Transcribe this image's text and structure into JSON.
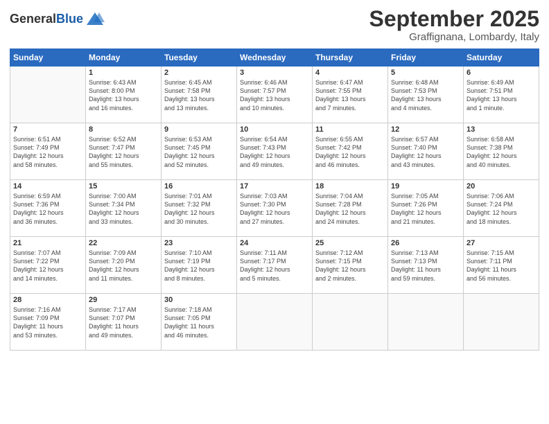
{
  "logo": {
    "general": "General",
    "blue": "Blue"
  },
  "title": "September 2025",
  "subtitle": "Graffignana, Lombardy, Italy",
  "days_of_week": [
    "Sunday",
    "Monday",
    "Tuesday",
    "Wednesday",
    "Thursday",
    "Friday",
    "Saturday"
  ],
  "weeks": [
    [
      {
        "num": "",
        "info": ""
      },
      {
        "num": "1",
        "info": "Sunrise: 6:43 AM\nSunset: 8:00 PM\nDaylight: 13 hours\nand 16 minutes."
      },
      {
        "num": "2",
        "info": "Sunrise: 6:45 AM\nSunset: 7:58 PM\nDaylight: 13 hours\nand 13 minutes."
      },
      {
        "num": "3",
        "info": "Sunrise: 6:46 AM\nSunset: 7:57 PM\nDaylight: 13 hours\nand 10 minutes."
      },
      {
        "num": "4",
        "info": "Sunrise: 6:47 AM\nSunset: 7:55 PM\nDaylight: 13 hours\nand 7 minutes."
      },
      {
        "num": "5",
        "info": "Sunrise: 6:48 AM\nSunset: 7:53 PM\nDaylight: 13 hours\nand 4 minutes."
      },
      {
        "num": "6",
        "info": "Sunrise: 6:49 AM\nSunset: 7:51 PM\nDaylight: 13 hours\nand 1 minute."
      }
    ],
    [
      {
        "num": "7",
        "info": "Sunrise: 6:51 AM\nSunset: 7:49 PM\nDaylight: 12 hours\nand 58 minutes."
      },
      {
        "num": "8",
        "info": "Sunrise: 6:52 AM\nSunset: 7:47 PM\nDaylight: 12 hours\nand 55 minutes."
      },
      {
        "num": "9",
        "info": "Sunrise: 6:53 AM\nSunset: 7:45 PM\nDaylight: 12 hours\nand 52 minutes."
      },
      {
        "num": "10",
        "info": "Sunrise: 6:54 AM\nSunset: 7:43 PM\nDaylight: 12 hours\nand 49 minutes."
      },
      {
        "num": "11",
        "info": "Sunrise: 6:55 AM\nSunset: 7:42 PM\nDaylight: 12 hours\nand 46 minutes."
      },
      {
        "num": "12",
        "info": "Sunrise: 6:57 AM\nSunset: 7:40 PM\nDaylight: 12 hours\nand 43 minutes."
      },
      {
        "num": "13",
        "info": "Sunrise: 6:58 AM\nSunset: 7:38 PM\nDaylight: 12 hours\nand 40 minutes."
      }
    ],
    [
      {
        "num": "14",
        "info": "Sunrise: 6:59 AM\nSunset: 7:36 PM\nDaylight: 12 hours\nand 36 minutes."
      },
      {
        "num": "15",
        "info": "Sunrise: 7:00 AM\nSunset: 7:34 PM\nDaylight: 12 hours\nand 33 minutes."
      },
      {
        "num": "16",
        "info": "Sunrise: 7:01 AM\nSunset: 7:32 PM\nDaylight: 12 hours\nand 30 minutes."
      },
      {
        "num": "17",
        "info": "Sunrise: 7:03 AM\nSunset: 7:30 PM\nDaylight: 12 hours\nand 27 minutes."
      },
      {
        "num": "18",
        "info": "Sunrise: 7:04 AM\nSunset: 7:28 PM\nDaylight: 12 hours\nand 24 minutes."
      },
      {
        "num": "19",
        "info": "Sunrise: 7:05 AM\nSunset: 7:26 PM\nDaylight: 12 hours\nand 21 minutes."
      },
      {
        "num": "20",
        "info": "Sunrise: 7:06 AM\nSunset: 7:24 PM\nDaylight: 12 hours\nand 18 minutes."
      }
    ],
    [
      {
        "num": "21",
        "info": "Sunrise: 7:07 AM\nSunset: 7:22 PM\nDaylight: 12 hours\nand 14 minutes."
      },
      {
        "num": "22",
        "info": "Sunrise: 7:09 AM\nSunset: 7:20 PM\nDaylight: 12 hours\nand 11 minutes."
      },
      {
        "num": "23",
        "info": "Sunrise: 7:10 AM\nSunset: 7:19 PM\nDaylight: 12 hours\nand 8 minutes."
      },
      {
        "num": "24",
        "info": "Sunrise: 7:11 AM\nSunset: 7:17 PM\nDaylight: 12 hours\nand 5 minutes."
      },
      {
        "num": "25",
        "info": "Sunrise: 7:12 AM\nSunset: 7:15 PM\nDaylight: 12 hours\nand 2 minutes."
      },
      {
        "num": "26",
        "info": "Sunrise: 7:13 AM\nSunset: 7:13 PM\nDaylight: 11 hours\nand 59 minutes."
      },
      {
        "num": "27",
        "info": "Sunrise: 7:15 AM\nSunset: 7:11 PM\nDaylight: 11 hours\nand 56 minutes."
      }
    ],
    [
      {
        "num": "28",
        "info": "Sunrise: 7:16 AM\nSunset: 7:09 PM\nDaylight: 11 hours\nand 53 minutes."
      },
      {
        "num": "29",
        "info": "Sunrise: 7:17 AM\nSunset: 7:07 PM\nDaylight: 11 hours\nand 49 minutes."
      },
      {
        "num": "30",
        "info": "Sunrise: 7:18 AM\nSunset: 7:05 PM\nDaylight: 11 hours\nand 46 minutes."
      },
      {
        "num": "",
        "info": ""
      },
      {
        "num": "",
        "info": ""
      },
      {
        "num": "",
        "info": ""
      },
      {
        "num": "",
        "info": ""
      }
    ]
  ]
}
